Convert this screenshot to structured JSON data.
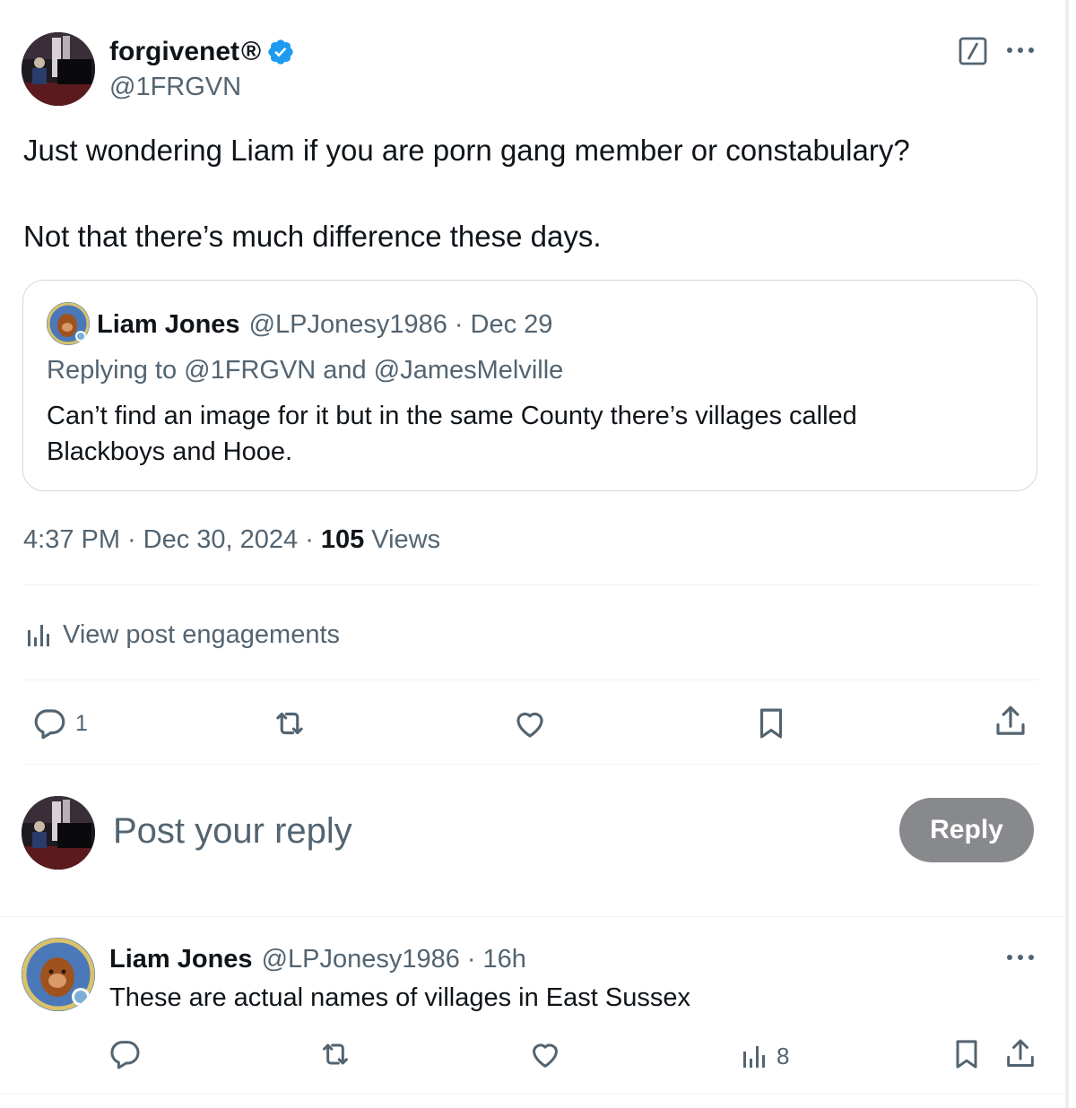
{
  "post": {
    "author_name": "forgivenet",
    "author_suffix": "®",
    "author_handle": "@1FRGVN",
    "text_line1": "Just wondering Liam if you are porn gang member or constabulary?",
    "text_line2": "Not that there’s much difference these days.",
    "time": "4:37 PM",
    "date": "Dec 30, 2024",
    "views_count": "105",
    "views_label": "Views",
    "engagements_label": "View post engagements",
    "reply_count": "1"
  },
  "quote": {
    "author_name": "Liam Jones",
    "author_handle": "@LPJonesy1986",
    "date": "Dec 29",
    "replying_prefix": "Replying to",
    "replying_to_1": "@1FRGVN",
    "replying_and": "and",
    "replying_to_2": "@JamesMelville",
    "text_line1": "Can’t find an image for it but in the same County there’s villages called",
    "text_line2": "Blackboys and Hooe."
  },
  "composer": {
    "placeholder": "Post your reply",
    "reply_button": "Reply"
  },
  "reply": {
    "author_name": "Liam Jones",
    "author_handle": "@LPJonesy1986",
    "time": "16h",
    "text": "These are actual names of villages in East Sussex",
    "views_count": "8"
  },
  "icons": {
    "verified": "verified-badge-icon",
    "grok": "grok-icon",
    "more": "more-icon",
    "analytics": "analytics-icon",
    "reply": "reply-icon",
    "repost": "repost-icon",
    "like": "like-icon",
    "bookmark": "bookmark-icon",
    "share": "share-icon"
  },
  "colors": {
    "verified_blue": "#1d9bf0",
    "text_primary": "#0f1419",
    "text_secondary": "#536471",
    "reply_button_disabled": "#87898c"
  }
}
